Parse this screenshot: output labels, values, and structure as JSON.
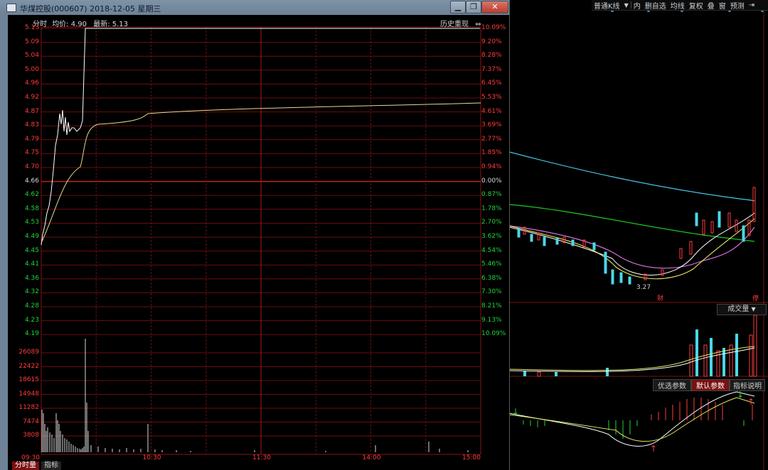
{
  "window": {
    "title": "华煤控股(000607) 2018-12-05 星期三",
    "buttons": [
      "▁",
      "❐",
      "✕"
    ]
  },
  "header": {
    "label_fenshi": "分时",
    "label_avg": "均价: 4.90",
    "label_last": "最新: 5.13",
    "history_button": "历史重现",
    "expand_icon": "⇔"
  },
  "price_axis": {
    "ticks": [
      "5.13",
      "5.09",
      "5.04",
      "5.00",
      "4.96",
      "4.92",
      "4.87",
      "4.83",
      "4.79",
      "4.75",
      "4.70",
      "4.66",
      "4.62",
      "4.58",
      "4.53",
      "4.49",
      "4.45",
      "4.41",
      "4.36",
      "4.32",
      "4.28",
      "4.23",
      "4.19"
    ],
    "pct": [
      "10.09%",
      "9.20%",
      "8.28%",
      "7.37%",
      "6.45%",
      "5.53%",
      "4.61%",
      "3.69%",
      "2.77%",
      "1.85%",
      "0.94%",
      "0.00%",
      "0.87%",
      "1.78%",
      "2.70%",
      "3.62%",
      "4.54%",
      "5.46%",
      "6.38%",
      "7.30%",
      "8.21%",
      "9.13%",
      "10.09%"
    ],
    "base": "4.66"
  },
  "volume_axis": {
    "ticks": [
      "26089",
      "22422",
      "18615",
      "14948",
      "11282",
      "7474",
      "3808"
    ]
  },
  "time_axis": {
    "ticks": [
      "09:30",
      "10:30",
      "11:30",
      "14:00",
      "15:00"
    ]
  },
  "bottom_tabs": {
    "tab1": "分时量",
    "tab2": "指标"
  },
  "right_toolbar": {
    "items": [
      "普通K线",
      "▼",
      "内",
      "删自选",
      "均线",
      "复权",
      "叠",
      "窗",
      "预测",
      "⇥"
    ]
  },
  "kline": {
    "low_marker": "3.27",
    "marker_cai": "财",
    "marker_end": "停"
  },
  "volume_panel": {
    "title": "成交量",
    "dropdown_icon": "▼"
  },
  "indicator_tabs": {
    "opt": "优选参数",
    "default": "默认参数",
    "help": "指标说明"
  },
  "colors": {
    "up": "#ff3c3c",
    "down": "#23d23c",
    "grid": "#7a1010",
    "price": "#ffffff",
    "avg": "#e8d890"
  }
}
